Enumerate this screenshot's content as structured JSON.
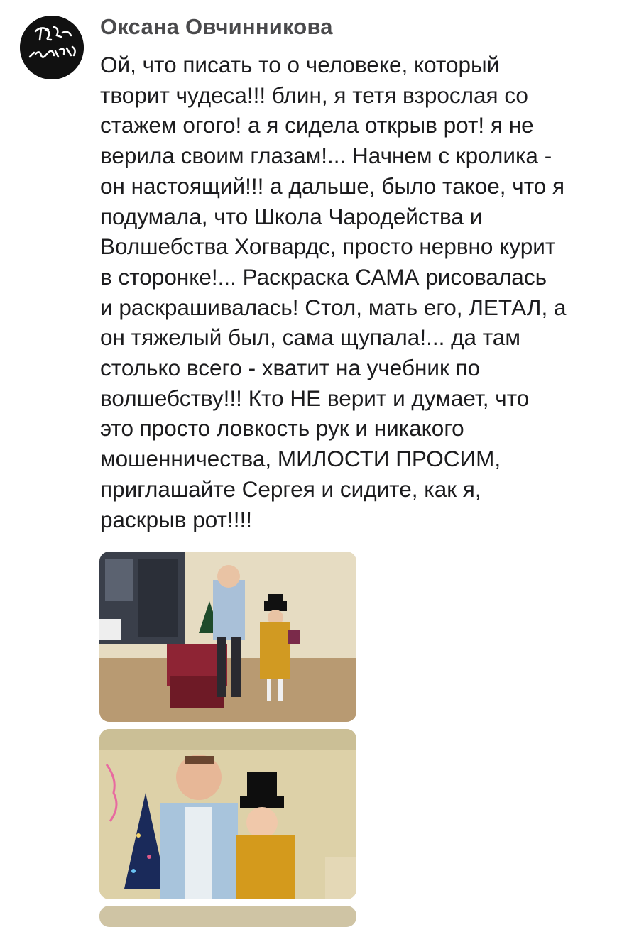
{
  "author": {
    "name": "Оксана Овчинникова",
    "avatar_icon": "hogbabochki-logo-avatar",
    "avatar_text": "ХогБабочки"
  },
  "post": {
    "text_lines": [
      "Ой, что писать то о человеке, который",
      "творит чудеса!!! блин, я тетя взрослая со",
      "стажем огого! а я сидела открыв рот! я не",
      "верила своим глазам!... Начнем с кролика -",
      "он настоящий!!! а дальше, было такое, что я",
      "подумала, что Школа Чародейства и",
      "Волшебства Хогвардс, просто нервно курит",
      "в сторонке!... Раскраска САМА рисовалась",
      "и раскрашивалась! Стол, мать его, ЛЕТАЛ, а",
      "он тяжелый был, сама щупала!... да там",
      "столько всего - хватит на учебник по",
      "волшебству!!! Кто НЕ верит и думает, что",
      "это просто ловкость рук и никакого",
      "мошенничества, МИЛОСТИ ПРОСИМ,",
      "приглашайте Сергея и сидите, как я,",
      "раскрыв рот!!!!"
    ]
  },
  "photos": [
    {
      "description_icon": "magician-with-girl-photo-icon"
    },
    {
      "description_icon": "magician-closeup-with-girl-photo-icon"
    },
    {
      "description_icon": "third-photo-icon"
    }
  ],
  "colors": {
    "author_name": "#4a4a4c",
    "text": "#1c1c1e",
    "background": "#ffffff"
  }
}
